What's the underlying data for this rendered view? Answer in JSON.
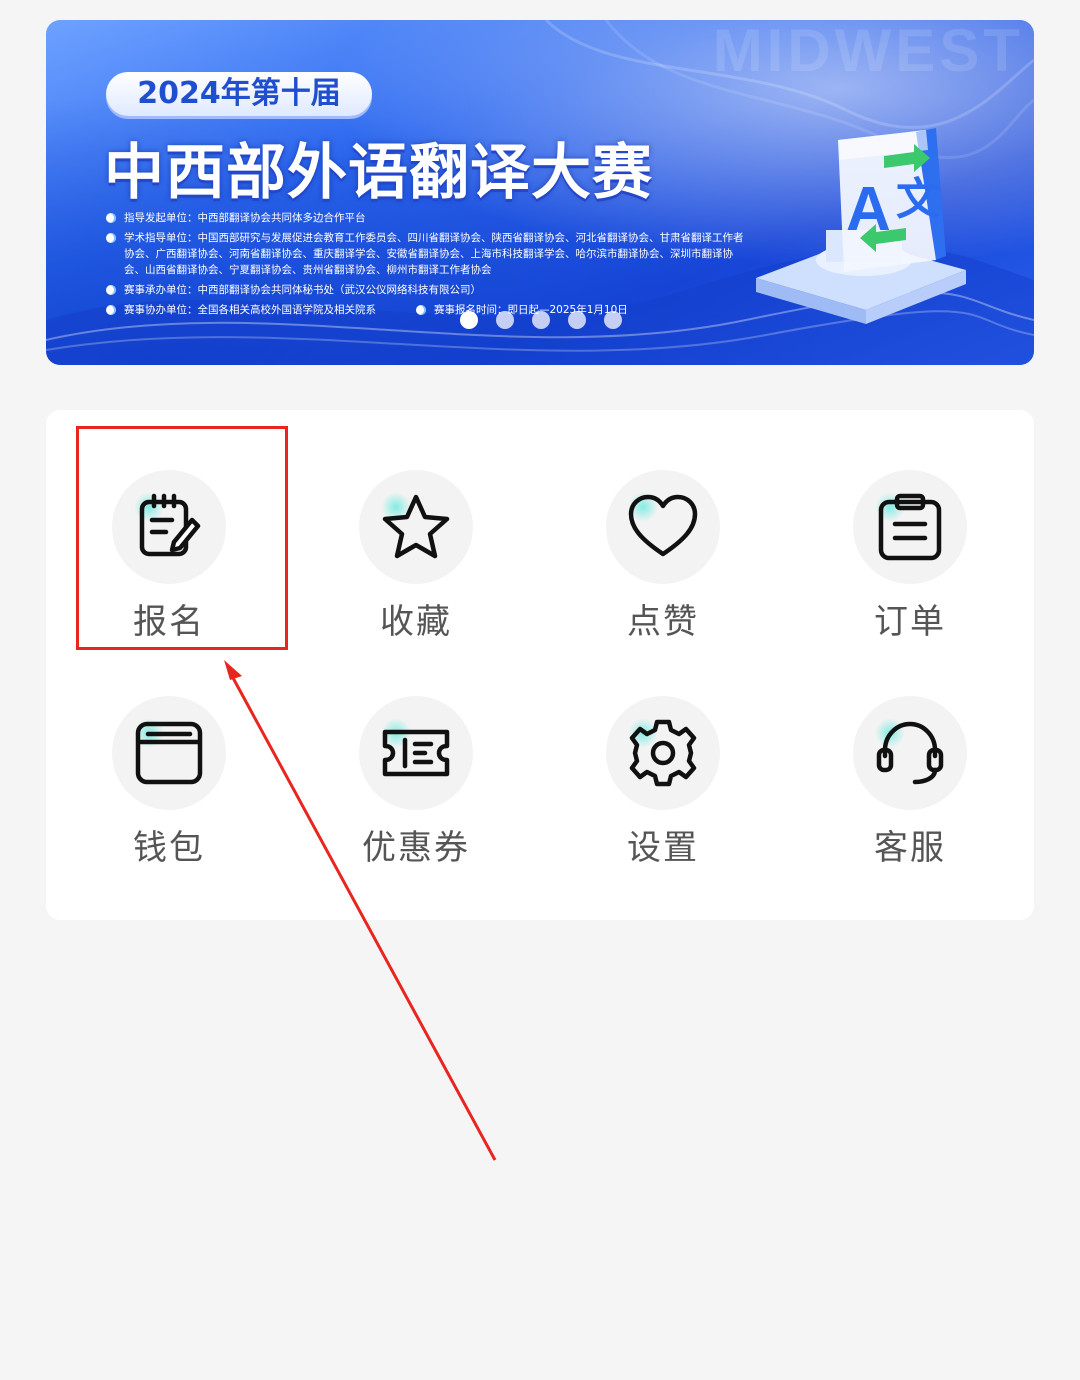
{
  "banner": {
    "edition": "2024年第十届",
    "title": "中西部外语翻译大赛",
    "watermark": "MIDWEST",
    "info": [
      "指导发起单位：中西部翻译协会共同体多边合作平台",
      "学术指导单位：中国西部研究与发展促进会教育工作委员会、四川省翻译协会、陕西省翻译协会、河北省翻译协会、甘肃省翻译工作者协会、广西翻译协会、河南省翻译协会、重庆翻译学会、安徽省翻译协会、上海市科技翻译学会、哈尔滨市翻译协会、深圳市翻译协会、山西省翻译协会、宁夏翻译协会、贵州省翻译协会、柳州市翻译工作者协会",
      "赛事承办单位：中西部翻译协会共同体秘书处（武汉公仪网络科技有限公司）",
      "赛事协办单位：全国各相关高校外国语学院及相关院系",
      "赛事报名时间：即日起—2025年1月10日"
    ],
    "slide_count": 5,
    "active_slide": 1,
    "icon_letters": [
      "A",
      "文"
    ]
  },
  "menu": {
    "items": [
      {
        "label": "报名",
        "icon": "signup-notepad-icon"
      },
      {
        "label": "收藏",
        "icon": "star-icon"
      },
      {
        "label": "点赞",
        "icon": "heart-icon"
      },
      {
        "label": "订单",
        "icon": "clipboard-icon"
      },
      {
        "label": "钱包",
        "icon": "wallet-icon"
      },
      {
        "label": "优惠券",
        "icon": "coupon-icon"
      },
      {
        "label": "设置",
        "icon": "gear-icon"
      },
      {
        "label": "客服",
        "icon": "headset-icon"
      }
    ]
  },
  "annotation": {
    "box_color": "#e8251f",
    "arrow_color": "#e8251f"
  },
  "colors": {
    "background": "#f5f5f5",
    "card": "#ffffff",
    "banner_blue": "#2f6af0",
    "label_gray": "#555555",
    "icon_tint": "#78ebe1"
  }
}
